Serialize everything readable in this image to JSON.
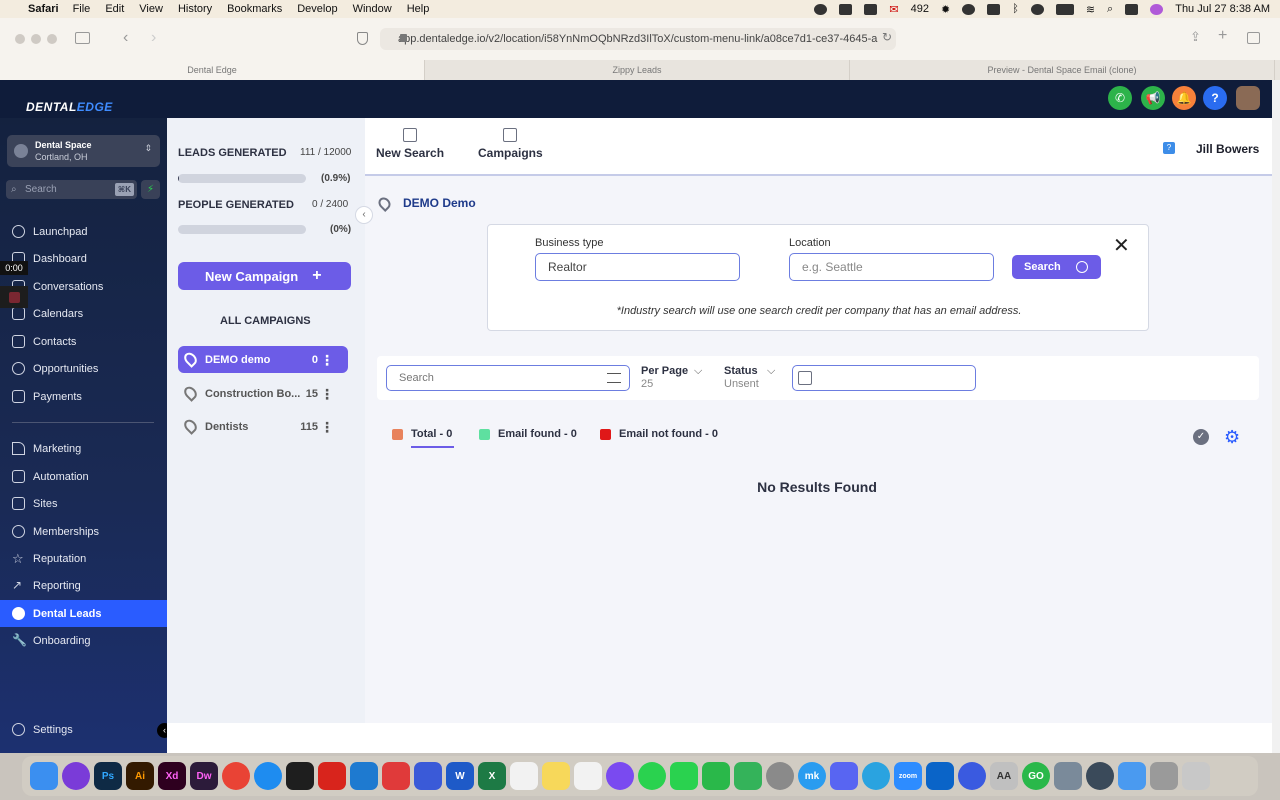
{
  "menubar": {
    "app": "Safari",
    "items": [
      "File",
      "Edit",
      "View",
      "History",
      "Bookmarks",
      "Develop",
      "Window",
      "Help"
    ],
    "mail_count": "492",
    "datetime": "Thu Jul 27  8:38 AM"
  },
  "browser": {
    "url": "app.dentaledge.io/v2/location/i58YnNmOQbNRzd3IlToX/custom-menu-link/a08ce7d1-ce37-4645-a",
    "tabs": [
      "Dental Edge",
      "Zippy Leads",
      "Preview - Dental Space Email (clone)"
    ]
  },
  "app": {
    "logo_a": "DENTAL",
    "logo_b": "EDGE",
    "help_label": "?"
  },
  "sidebar": {
    "location_name": "Dental Space",
    "location_sub": "Cortland, OH",
    "search_placeholder": "Search",
    "search_kbd": "⌘K",
    "items": [
      {
        "label": "Launchpad",
        "icon": "rocket-icon"
      },
      {
        "label": "Dashboard",
        "icon": "dashboard-icon"
      },
      {
        "label": "Conversations",
        "icon": "chat-icon"
      },
      {
        "label": "Calendars",
        "icon": "calendar-icon"
      },
      {
        "label": "Contacts",
        "icon": "contacts-icon"
      },
      {
        "label": "Opportunities",
        "icon": "opportunities-icon"
      },
      {
        "label": "Payments",
        "icon": "payments-icon"
      },
      {
        "label": "Marketing",
        "icon": "send-icon"
      },
      {
        "label": "Automation",
        "icon": "automation-icon"
      },
      {
        "label": "Sites",
        "icon": "sites-icon"
      },
      {
        "label": "Memberships",
        "icon": "memberships-icon"
      },
      {
        "label": "Reputation",
        "icon": "star-icon"
      },
      {
        "label": "Reporting",
        "icon": "chart-icon"
      },
      {
        "label": "Dental Leads",
        "icon": "people-icon",
        "active": true
      },
      {
        "label": "Onboarding",
        "icon": "wrench-icon"
      }
    ],
    "settings_label": "Settings",
    "recording_time": "0:00"
  },
  "campaigns_panel": {
    "leads_label": "LEADS GENERATED",
    "leads_value": "111 / 12000",
    "leads_pct": "(0.9%)",
    "leads_fraction": 0.009,
    "people_label": "PEOPLE GENERATED",
    "people_value": "0 / 2400",
    "people_pct": "(0%)",
    "people_fraction": 0,
    "new_campaign_label": "New Campaign",
    "all_campaigns_label": "ALL CAMPAIGNS",
    "campaigns": [
      {
        "name": "DEMO demo",
        "count": "0",
        "active": true
      },
      {
        "name": "Construction Bo...",
        "count": "15"
      },
      {
        "name": "Dentists",
        "count": "115"
      }
    ]
  },
  "main": {
    "tabs": [
      {
        "label": "New Search",
        "icon": "home-icon"
      },
      {
        "label": "Campaigns",
        "icon": "campaigns-icon"
      }
    ],
    "user_name": "Jill Bowers",
    "campaign_title": "DEMO Demo",
    "business_type_label": "Business type",
    "business_type_value": "Realtor",
    "location_label": "Location",
    "location_placeholder": "e.g. Seattle",
    "search_button": "Search",
    "note": "*Industry search will use one search credit per company that has an email address.",
    "filter_search_placeholder": "Search",
    "per_page_label": "Per Page",
    "per_page_value": "25",
    "status_label": "Status",
    "status_value": "Unsent",
    "legend": [
      {
        "label": "Total - 0",
        "color": "#e8825c"
      },
      {
        "label": "Email found - 0",
        "color": "#5ee0a0"
      },
      {
        "label": "Email not found - 0",
        "color": "#e01818"
      }
    ],
    "empty_message": "No Results Found"
  },
  "colors": {
    "accent": "#6c5ce7",
    "active_nav": "#2a5cff",
    "sidebar_bg": "#14223f"
  }
}
